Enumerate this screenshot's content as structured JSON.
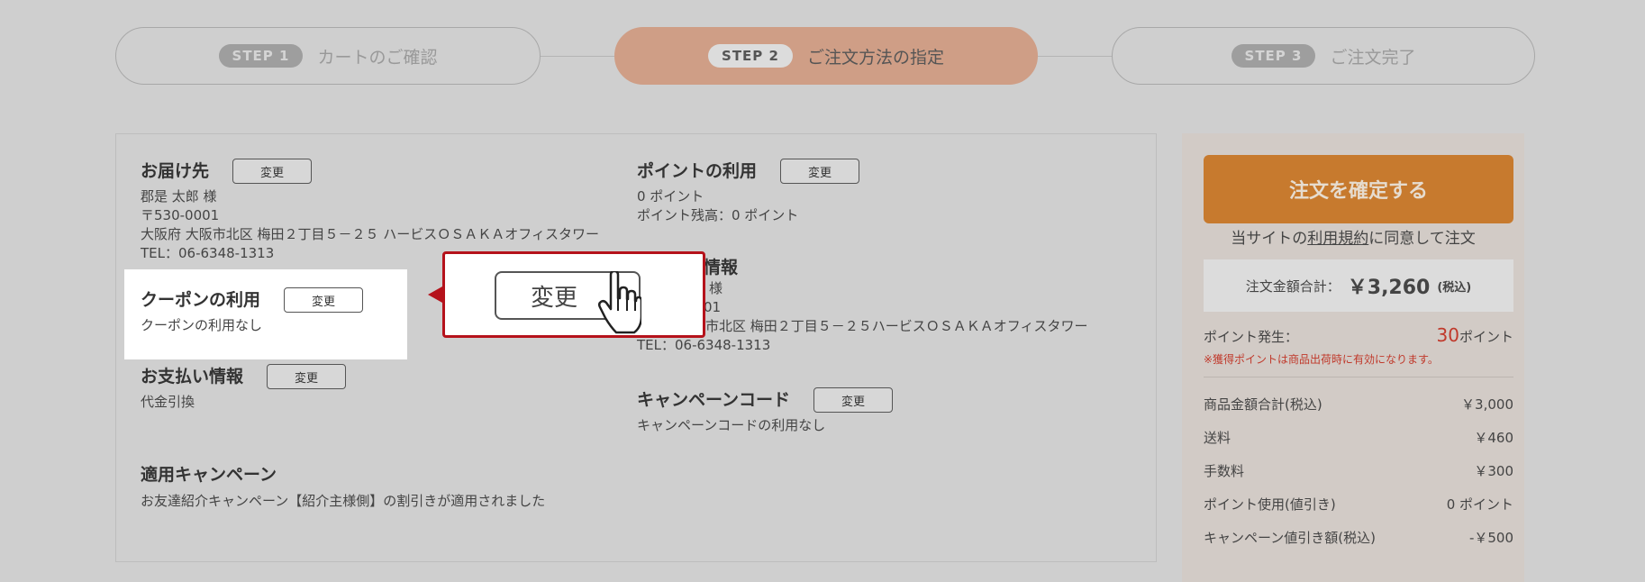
{
  "steps": [
    {
      "badge": "STEP 1",
      "label": "カートのご確認"
    },
    {
      "badge": "STEP 2",
      "label": "ご注文方法の指定"
    },
    {
      "badge": "STEP 3",
      "label": "ご注文完了"
    }
  ],
  "delivery": {
    "title": "お届け先",
    "change_label": "変更",
    "name": "郡是 太郎 様",
    "zip": "〒530-0001",
    "address": "大阪府 大阪市北区 梅田２丁目５－２５ ハービスＯＳＡＫＡオフィスタワー",
    "tel": "TEL：06-6348-1313"
  },
  "coupon": {
    "title": "クーポンの利用",
    "change_label": "変更",
    "value": "クーポンの利用なし"
  },
  "payment": {
    "title": "お支払い情報",
    "change_label": "変更",
    "value": "代金引換"
  },
  "campaign_applied": {
    "title": "適用キャンペーン",
    "value": "お友達紹介キャンペーン【紹介主様側】の割引きが適用されました"
  },
  "points": {
    "title": "ポイントの利用",
    "change_label": "変更",
    "value": "0 ポイント",
    "balance": "ポイント残高：0 ポイント"
  },
  "orderer": {
    "title_partial": "情報",
    "name_partial": "様",
    "zip_partial": "01",
    "address_partial": "市北区 梅田２丁目５－２５ハービスＯＳＡＫＡオフィスタワー",
    "tel": "TEL：06-6348-1313"
  },
  "campaign_code": {
    "title": "キャンペーンコード",
    "change_label": "変更",
    "value": "キャンペーンコードの利用なし"
  },
  "callout": {
    "button_label": "変更",
    "border_color": "#b5121b"
  },
  "sidebar": {
    "confirm_label": "注文を確定する",
    "agree_prefix": "当サイトの",
    "agree_link": "利用規約",
    "agree_suffix": "に同意して注文",
    "total_label": "注文金額合計：",
    "total_value": "￥3,260",
    "total_tax": "(税込)",
    "points_label": "ポイント発生：",
    "points_num": "30",
    "points_unit": "ポイント",
    "points_note": "※獲得ポイントは商品出荷時に有効になります。",
    "rows": [
      {
        "label": "商品金額合計(税込)",
        "value": "￥3,000"
      },
      {
        "label": "送料",
        "value": "￥460"
      },
      {
        "label": "手数料",
        "value": "￥300"
      },
      {
        "label": "ポイント使用(値引き)",
        "value": "0 ポイント"
      },
      {
        "label": "キャンペーン値引き額(税込)",
        "value": "-￥500"
      }
    ]
  },
  "colors": {
    "accent": "#c77a2e",
    "step_active": "#cf9e86",
    "alert": "#c0392b"
  }
}
